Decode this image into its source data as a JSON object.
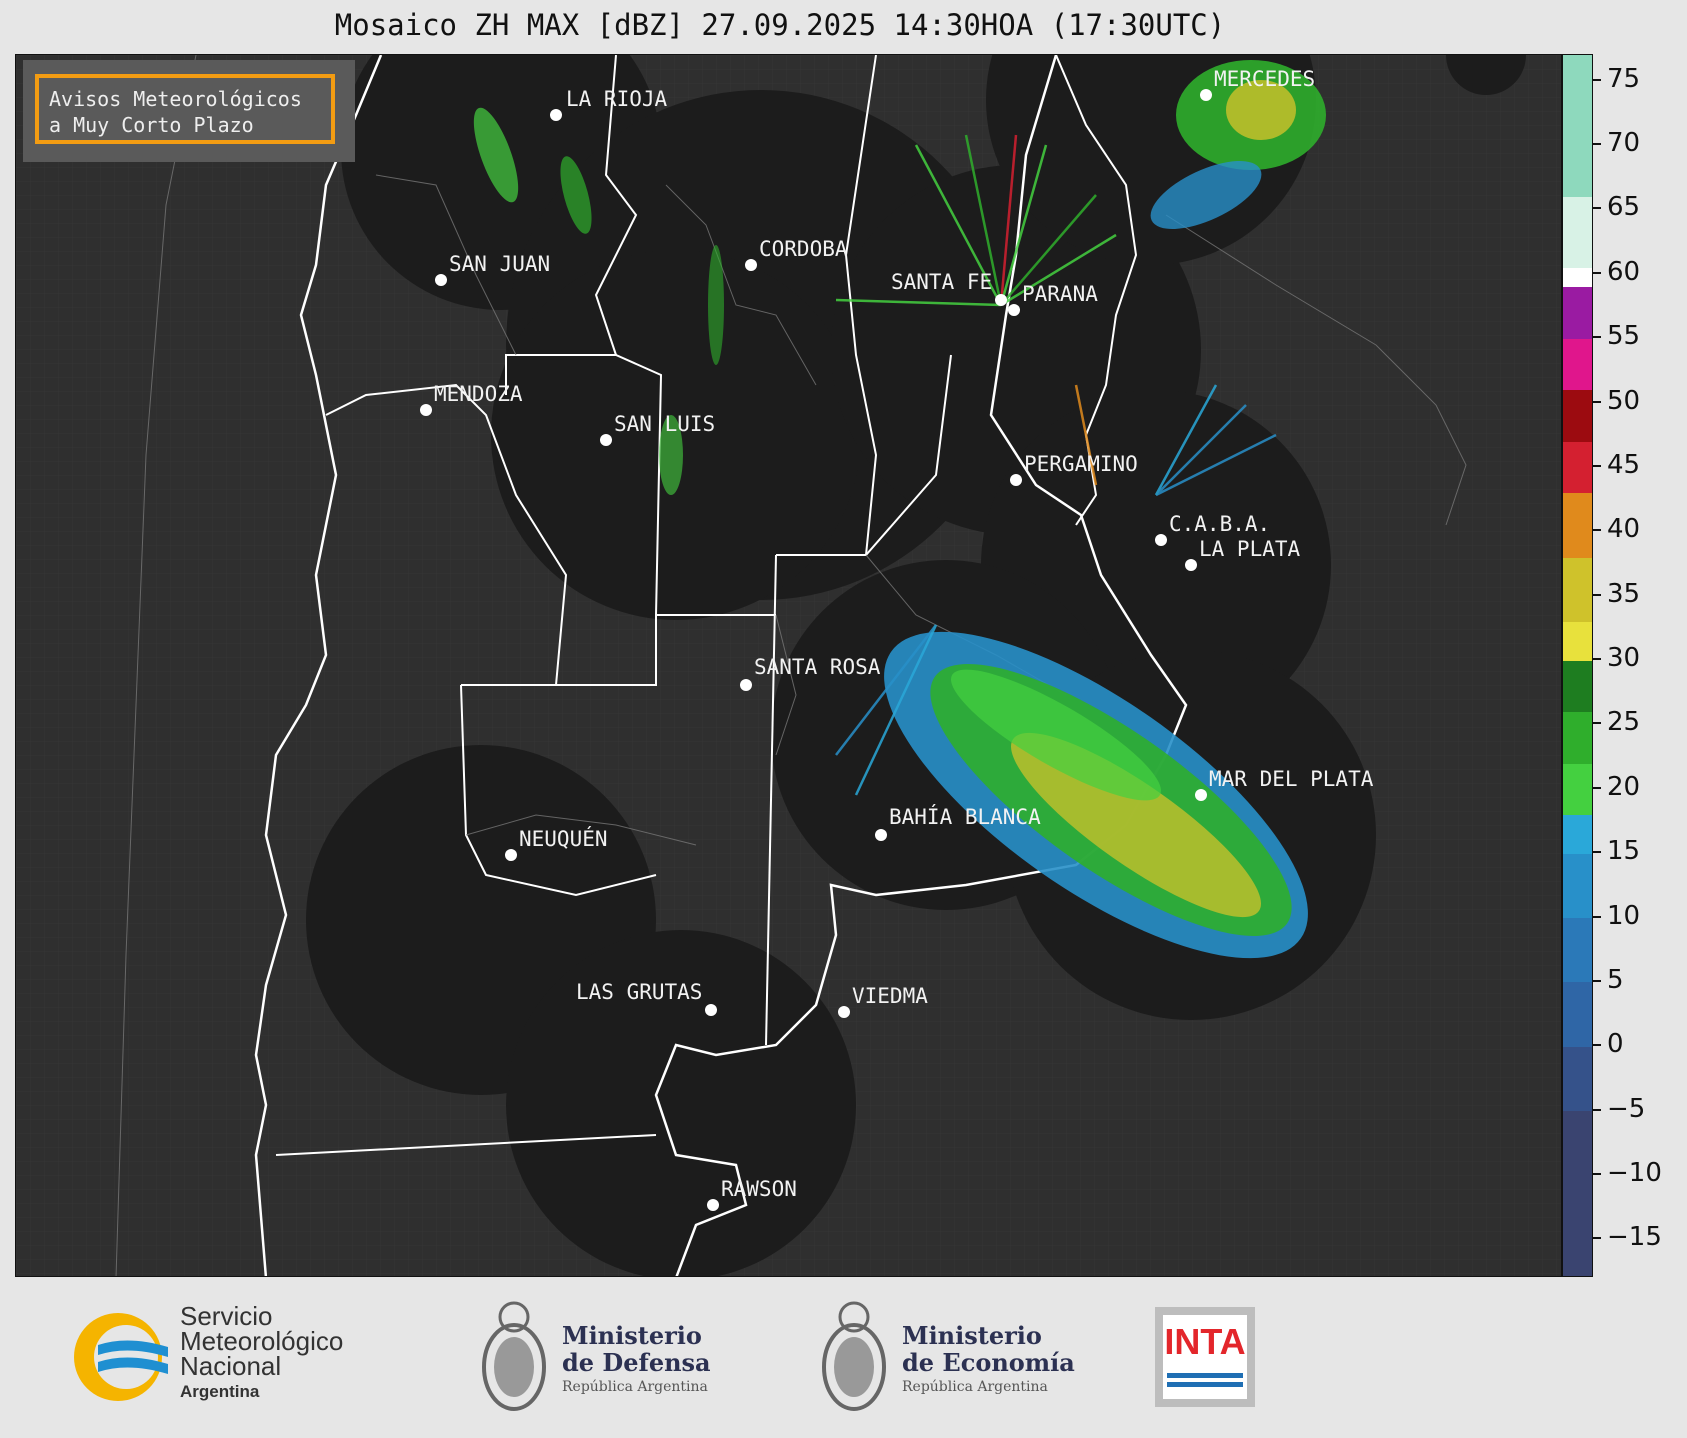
{
  "title": "Mosaico ZH MAX [dBZ] 27.09.2025 14:30HOA (17:30UTC)",
  "notice": {
    "line1": "Avisos Meteorológicos",
    "line2": "a Muy Corto Plazo",
    "border_color": "#f39c12"
  },
  "cities": [
    {
      "name": "LA RIOJA"
    },
    {
      "name": "SAN JUAN"
    },
    {
      "name": "CORDOBA"
    },
    {
      "name": "SANTA FE"
    },
    {
      "name": "PARANA"
    },
    {
      "name": "MERCEDES"
    },
    {
      "name": "MENDOZA"
    },
    {
      "name": "SAN LUIS"
    },
    {
      "name": "PERGAMINO"
    },
    {
      "name": "C.A.B.A."
    },
    {
      "name": "LA PLATA"
    },
    {
      "name": "SANTA ROSA"
    },
    {
      "name": "MAR DEL PLATA"
    },
    {
      "name": "BAHÍA BLANCA"
    },
    {
      "name": "NEUQUÉN"
    },
    {
      "name": "LAS GRUTAS"
    },
    {
      "name": "VIEDMA"
    },
    {
      "name": "RAWSON"
    }
  ],
  "colorbar": {
    "min": -18,
    "max": 77,
    "ticks": [
      "75",
      "70",
      "65",
      "60",
      "55",
      "50",
      "45",
      "40",
      "35",
      "30",
      "25",
      "20",
      "15",
      "10",
      "5",
      "0",
      "−5",
      "−10",
      "−15"
    ],
    "tick_values": [
      75,
      70,
      65,
      60,
      55,
      50,
      45,
      40,
      35,
      30,
      25,
      20,
      15,
      10,
      5,
      0,
      -5,
      -10,
      -15
    ],
    "bands": [
      {
        "from": -18,
        "to": -5,
        "color": "#3a4470"
      },
      {
        "from": -5,
        "to": 0,
        "color": "#35528a"
      },
      {
        "from": 0,
        "to": 5,
        "color": "#2f66a6"
      },
      {
        "from": 5,
        "to": 10,
        "color": "#2b79b8"
      },
      {
        "from": 10,
        "to": 15,
        "color": "#2890c9"
      },
      {
        "from": 15,
        "to": 18,
        "color": "#2aa8d9"
      },
      {
        "from": 18,
        "to": 22,
        "color": "#44d040"
      },
      {
        "from": 22,
        "to": 26,
        "color": "#2fae2c"
      },
      {
        "from": 26,
        "to": 30,
        "color": "#1e7d20"
      },
      {
        "from": 30,
        "to": 33,
        "color": "#e8e13c"
      },
      {
        "from": 33,
        "to": 38,
        "color": "#cfc22b"
      },
      {
        "from": 38,
        "to": 43,
        "color": "#e08a1c"
      },
      {
        "from": 43,
        "to": 47,
        "color": "#d42030"
      },
      {
        "from": 47,
        "to": 51,
        "color": "#9c0b10"
      },
      {
        "from": 51,
        "to": 55,
        "color": "#e0168c"
      },
      {
        "from": 55,
        "to": 59,
        "color": "#9a1ba2"
      },
      {
        "from": 59,
        "to": 60.5,
        "color": "#ffffff"
      },
      {
        "from": 60.5,
        "to": 66,
        "color": "#d8f2e6"
      },
      {
        "from": 66,
        "to": 77,
        "color": "#8ed9bd"
      }
    ]
  },
  "logos": {
    "smn": {
      "line1": "Servicio",
      "line2": "Meteorológico",
      "line3": "Nacional",
      "line4": "Argentina"
    },
    "defensa": {
      "line1": "Ministerio",
      "line2": "de Defensa",
      "line3": "República Argentina"
    },
    "economia": {
      "line1": "Ministerio",
      "line2": "de Economía",
      "line3": "República Argentina"
    },
    "inta": {
      "text": "INTA"
    }
  }
}
